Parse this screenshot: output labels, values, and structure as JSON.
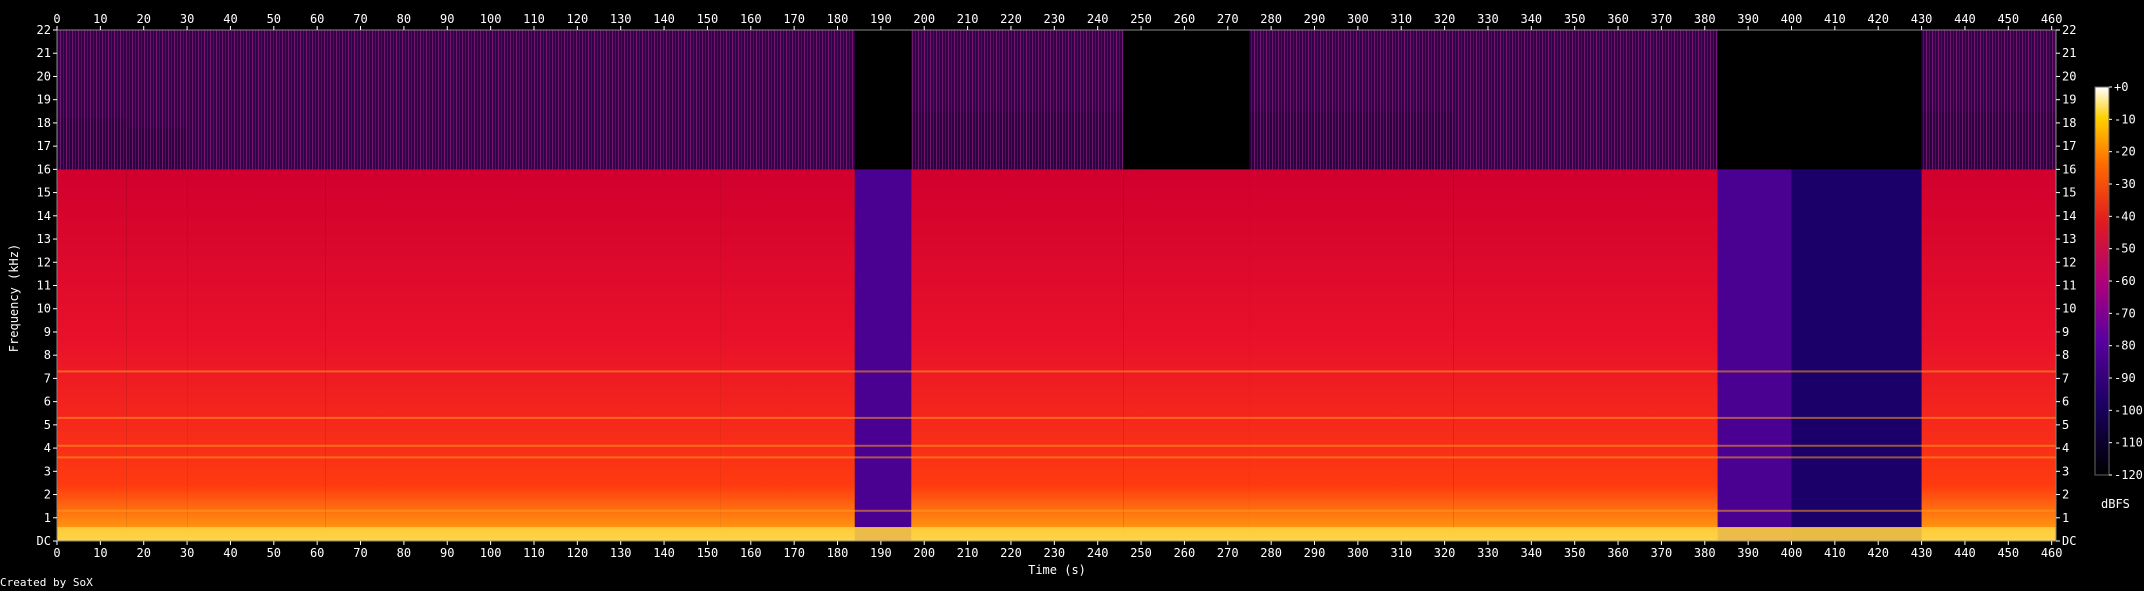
{
  "chart_data": {
    "type": "heatmap",
    "title": "",
    "xlabel": "Time (s)",
    "ylabel": "Frequency (kHz)",
    "xlim": [
      0,
      461
    ],
    "ylim": [
      0,
      22
    ],
    "x_ticks": [
      0,
      10,
      20,
      30,
      40,
      50,
      60,
      70,
      80,
      90,
      100,
      110,
      120,
      130,
      140,
      150,
      160,
      170,
      180,
      190,
      200,
      210,
      220,
      230,
      240,
      250,
      260,
      270,
      280,
      290,
      300,
      310,
      320,
      330,
      340,
      350,
      360,
      370,
      380,
      390,
      400,
      410,
      420,
      430,
      440,
      450,
      460
    ],
    "y_ticks": [
      "DC",
      "1",
      "2",
      "3",
      "4",
      "5",
      "6",
      "7",
      "8",
      "9",
      "10",
      "11",
      "12",
      "13",
      "14",
      "15",
      "16",
      "17",
      "18",
      "19",
      "20",
      "21",
      "22"
    ],
    "colorbar": {
      "label": "dBFS",
      "ticks": [
        "+0",
        "-10",
        "-20",
        "-30",
        "-40",
        "-50",
        "-60",
        "-70",
        "-80",
        "-90",
        "-100",
        "-110",
        "-120"
      ],
      "range": [
        -120,
        0
      ]
    },
    "segments": [
      {
        "start": 0,
        "end": 16,
        "cutoff_khz": 18.2,
        "level": "loud"
      },
      {
        "start": 16,
        "end": 30,
        "cutoff_khz": 17.8,
        "level": "loud"
      },
      {
        "start": 30,
        "end": 62,
        "cutoff_khz": 16.0,
        "level": "loud"
      },
      {
        "start": 62,
        "end": 153,
        "cutoff_khz": 16.0,
        "level": "loud"
      },
      {
        "start": 153,
        "end": 168,
        "cutoff_khz": 16.0,
        "level": "loud"
      },
      {
        "start": 168,
        "end": 184,
        "cutoff_khz": 16.0,
        "level": "loud"
      },
      {
        "start": 184,
        "end": 197,
        "cutoff_khz": 16.0,
        "level": "quiet"
      },
      {
        "start": 197,
        "end": 246,
        "cutoff_khz": 18.5,
        "level": "loud"
      },
      {
        "start": 246,
        "end": 275,
        "cutoff_khz": 16.0,
        "level": "medium"
      },
      {
        "start": 275,
        "end": 322,
        "cutoff_khz": 18.5,
        "level": "loud"
      },
      {
        "start": 322,
        "end": 383,
        "cutoff_khz": 16.0,
        "level": "loud"
      },
      {
        "start": 383,
        "end": 400,
        "cutoff_khz": 16.0,
        "level": "quiet"
      },
      {
        "start": 400,
        "end": 430,
        "cutoff_khz": 16.0,
        "level": "very-quiet"
      },
      {
        "start": 430,
        "end": 461,
        "cutoff_khz": 18.5,
        "level": "loud"
      }
    ],
    "grid": false,
    "legend": "colorbar-right"
  },
  "footer": {
    "credit": "Created by SoX"
  }
}
